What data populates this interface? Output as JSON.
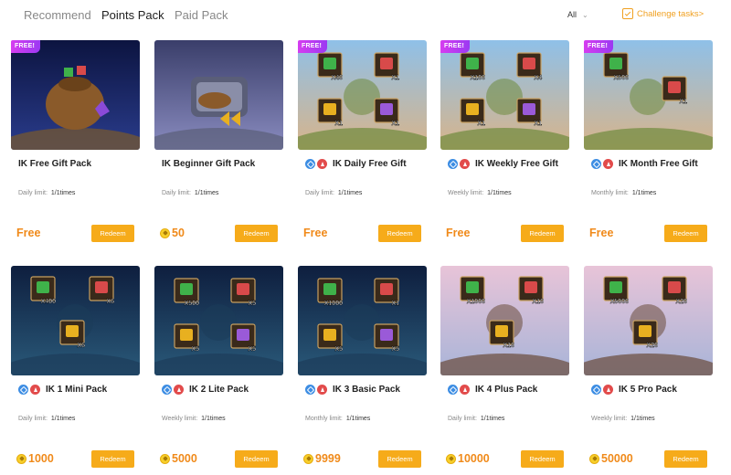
{
  "tabs": [
    {
      "label": "Recommend",
      "active": false
    },
    {
      "label": "Points Pack",
      "active": true
    },
    {
      "label": "Paid Pack",
      "active": false
    }
  ],
  "filter": {
    "value": "All"
  },
  "challenge": {
    "label": "Challenge tasks>"
  },
  "colors": {
    "accent": "#f6ab1a",
    "price": "#f08a1a",
    "badge": "#c83cf0"
  },
  "cards": [
    {
      "title": "IK Free Gift Pack",
      "badge": "FREE!",
      "pills": false,
      "limit_label": "Daily limit:",
      "limit_value": "1/1times",
      "price": "Free",
      "coin": false,
      "button": "Redeem",
      "theme": "bag",
      "items": []
    },
    {
      "title": "IK Beginner Gift Pack",
      "badge": "",
      "pills": false,
      "limit_label": "Daily limit:",
      "limit_value": "1/1times",
      "price": "50",
      "coin": true,
      "button": "Redeem",
      "theme": "chest",
      "items": []
    },
    {
      "title": "IK Daily Free Gift",
      "badge": "FREE!",
      "pills": true,
      "limit_label": "Daily limit:",
      "limit_value": "1/1times",
      "price": "Free",
      "coin": false,
      "button": "Redeem",
      "theme": "field",
      "items": [
        "X40",
        "X1",
        "X1",
        "X1"
      ]
    },
    {
      "title": "IK Weekly Free Gift",
      "badge": "FREE!",
      "pills": true,
      "limit_label": "Weekly limit:",
      "limit_value": "1/1times",
      "price": "Free",
      "coin": false,
      "button": "Redeem",
      "theme": "field",
      "items": [
        "X100",
        "X4",
        "X1",
        "X1"
      ]
    },
    {
      "title": "IK Month Free Gift",
      "badge": "FREE!",
      "pills": true,
      "limit_label": "Monthly limit:",
      "limit_value": "1/1times",
      "price": "Free",
      "coin": false,
      "button": "Redeem",
      "theme": "field",
      "items": [
        "X500",
        "X1"
      ]
    },
    {
      "title": "IK 1 Mini Pack",
      "badge": "",
      "pills": true,
      "limit_label": "Daily limit:",
      "limit_value": "1/1times",
      "price": "1000",
      "coin": true,
      "button": "Redeem",
      "theme": "night",
      "items": [
        "X400",
        "X6",
        "X6"
      ]
    },
    {
      "title": "IK 2 Lite Pack",
      "badge": "",
      "pills": true,
      "limit_label": "Weekly limit:",
      "limit_value": "1/1times",
      "price": "5000",
      "coin": true,
      "button": "Redeem",
      "theme": "night",
      "items": [
        "X500",
        "X5",
        "X5",
        "X5"
      ]
    },
    {
      "title": "IK 3 Basic Pack",
      "badge": "",
      "pills": true,
      "limit_label": "Monthly limit:",
      "limit_value": "1/1times",
      "price": "9999",
      "coin": true,
      "button": "Redeem",
      "theme": "night",
      "items": [
        "X1000",
        "X1",
        "X5",
        "X5"
      ]
    },
    {
      "title": "IK 4 Plus Pack",
      "badge": "",
      "pills": true,
      "limit_label": "Daily limit:",
      "limit_value": "1/1times",
      "price": "10000",
      "coin": true,
      "button": "Redeem",
      "theme": "ship",
      "items": [
        "X1000",
        "X10",
        "X10"
      ]
    },
    {
      "title": "IK 5 Pro Pack",
      "badge": "",
      "pills": true,
      "limit_label": "Weekly limit:",
      "limit_value": "1/1times",
      "price": "50000",
      "coin": true,
      "button": "Redeem",
      "theme": "ship",
      "items": [
        "X5000",
        "X20",
        "X20"
      ]
    }
  ]
}
